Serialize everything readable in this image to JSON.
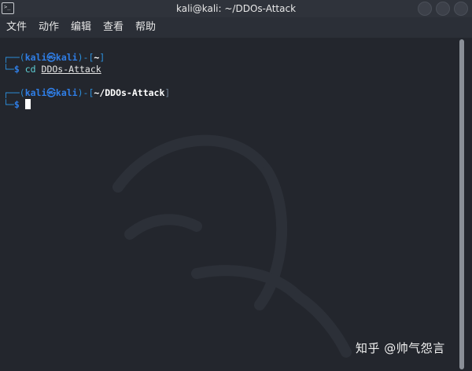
{
  "window": {
    "title": "kali@kali: ~/DDOs-Attack",
    "app_icon": "terminal-icon",
    "buttons": [
      "minimize-icon",
      "maximize-icon",
      "close-icon"
    ]
  },
  "menu": {
    "items": [
      {
        "label": "文件"
      },
      {
        "label": "动作"
      },
      {
        "label": "编辑"
      },
      {
        "label": "查看"
      },
      {
        "label": "帮助"
      }
    ]
  },
  "terminal": {
    "prompt1": {
      "frame_top": "┌──(",
      "user": "kali",
      "at_symbol": "㉿",
      "host": "kali",
      "close_open": ")-[",
      "path": "~",
      "close_bracket": "]",
      "frame_bottom": "└─",
      "dollar": "$",
      "command": "cd",
      "argument": "DDOs-Attack"
    },
    "prompt2": {
      "frame_top": "┌──(",
      "user": "kali",
      "at_symbol": "㉿",
      "host": "kali",
      "close_open": ")-[",
      "path": "~/DDOs-Attack",
      "close_bracket": "]",
      "frame_bottom": "└─",
      "dollar": "$"
    }
  },
  "watermark": "知乎 @帅气怨言",
  "colors": {
    "background": "#23262d",
    "prompt_blue": "#2f7ee6",
    "command_cyan": "#5fd0d6"
  }
}
